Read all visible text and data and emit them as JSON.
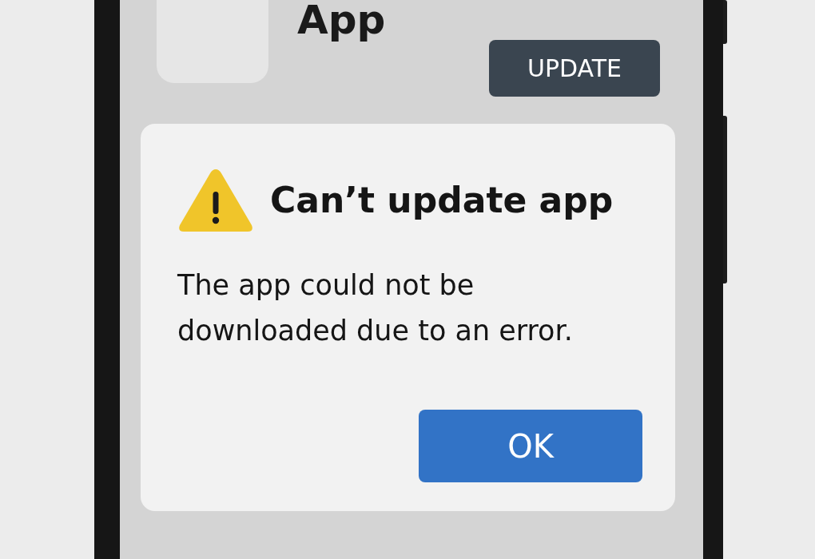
{
  "app_header": {
    "title": "App",
    "button": "UPDATE"
  },
  "dialog": {
    "title": "Can’t update app",
    "message": "The app could not be downloaded due to an error.",
    "button": "OK"
  }
}
